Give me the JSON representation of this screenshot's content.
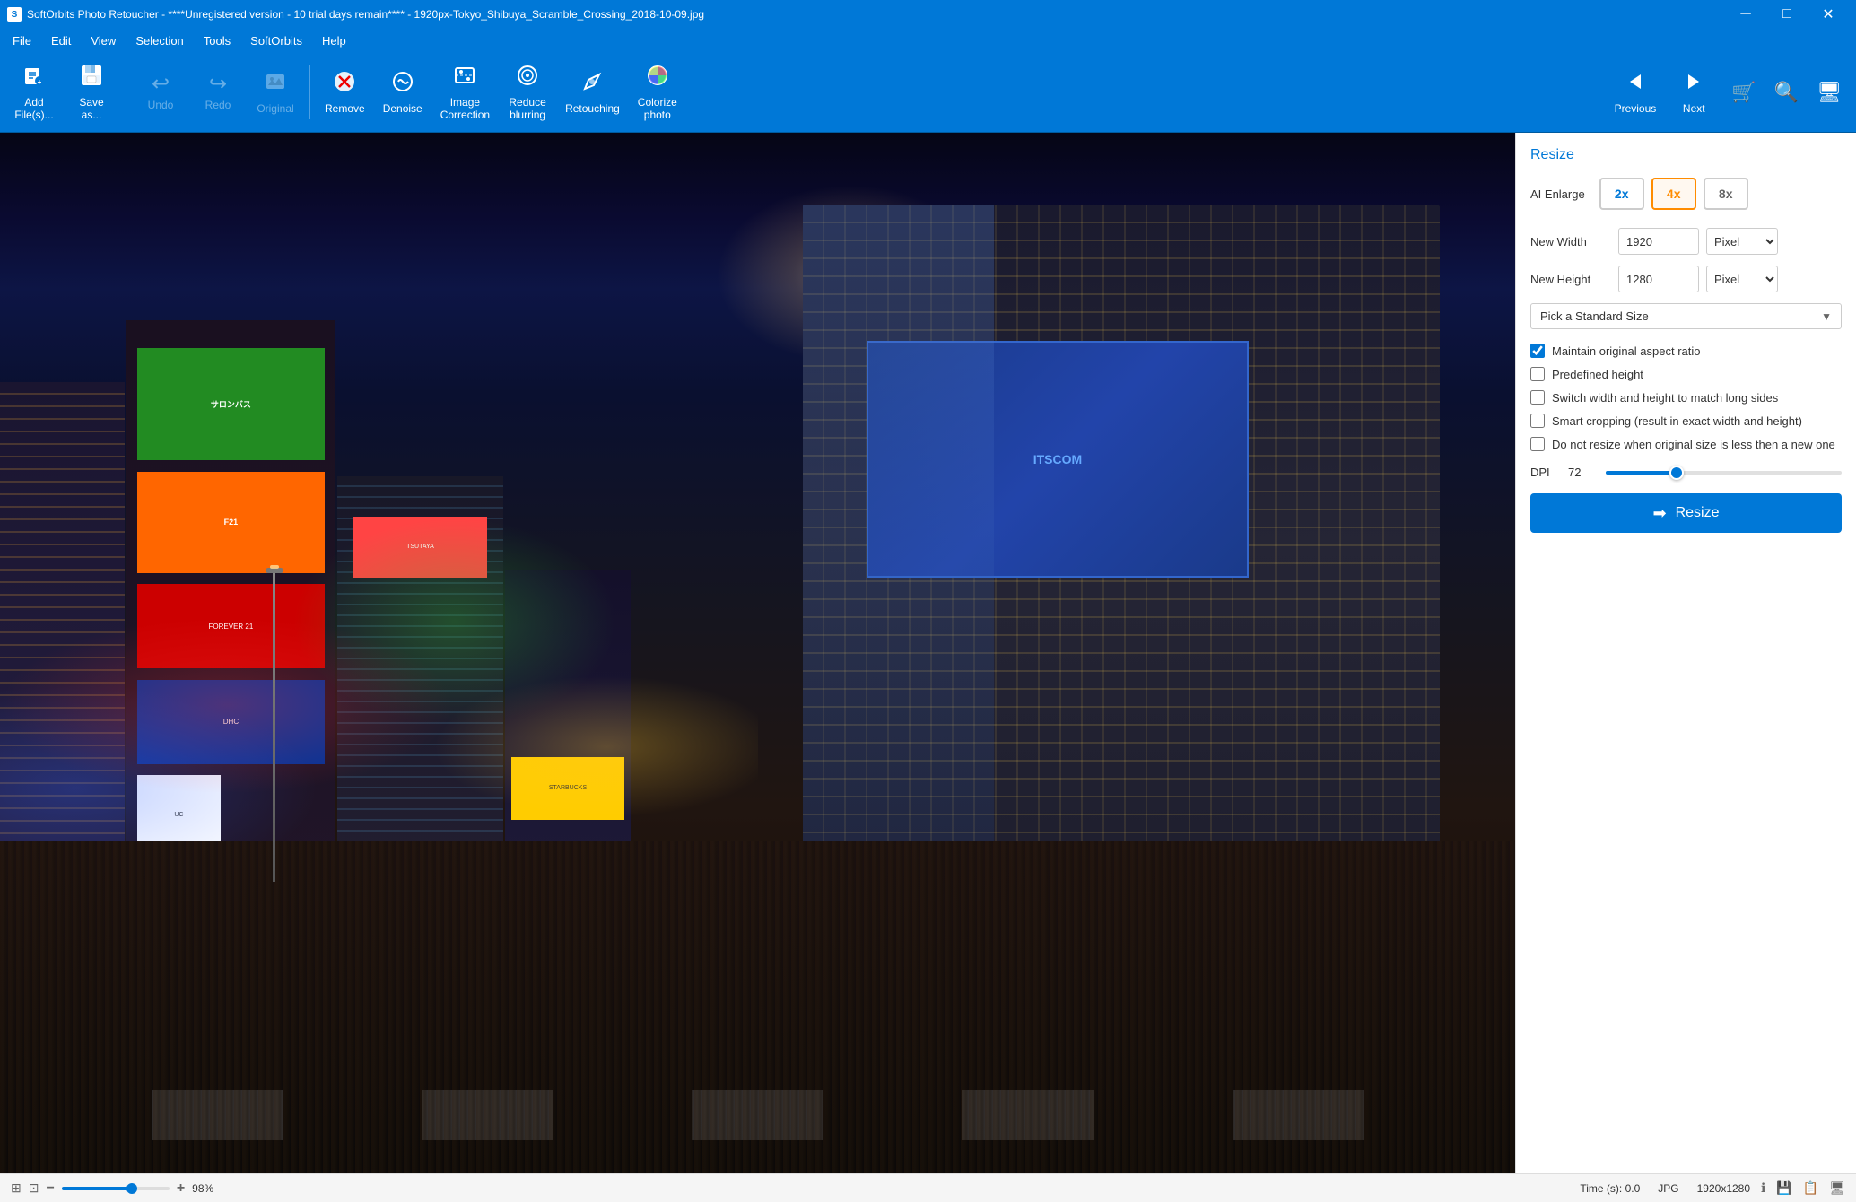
{
  "window": {
    "title": "SoftOrbits Photo Retoucher - ****Unregistered version - 10 trial days remain**** - 1920px-Tokyo_Shibuya_Scramble_Crossing_2018-10-09.jpg",
    "controls": {
      "minimize": "─",
      "maximize": "□",
      "close": "✕"
    }
  },
  "menu": {
    "items": [
      "File",
      "Edit",
      "View",
      "Selection",
      "Tools",
      "SoftOrbits",
      "Help"
    ]
  },
  "toolbar": {
    "buttons": [
      {
        "id": "add-files",
        "icon": "📄",
        "label": "Add\nFile(s)..."
      },
      {
        "id": "save-as",
        "icon": "💾",
        "label": "Save\nas..."
      },
      {
        "id": "undo",
        "icon": "↩",
        "label": "Undo",
        "disabled": true
      },
      {
        "id": "redo",
        "icon": "↪",
        "label": "Redo",
        "disabled": true
      },
      {
        "id": "original",
        "icon": "🖼",
        "label": "Original",
        "disabled": true
      },
      {
        "id": "remove",
        "icon": "✂",
        "label": "Remove"
      },
      {
        "id": "denoise",
        "icon": "🔧",
        "label": "Denoise"
      },
      {
        "id": "image-correction",
        "icon": "⚙",
        "label": "Image\nCorrection"
      },
      {
        "id": "reduce-blurring",
        "icon": "◎",
        "label": "Reduce\nblurring"
      },
      {
        "id": "retouching",
        "icon": "✏",
        "label": "Retouching"
      },
      {
        "id": "colorize-photo",
        "icon": "🎨",
        "label": "Colorize\nphoto"
      }
    ],
    "right_buttons": [
      {
        "id": "previous",
        "icon": "◁",
        "label": "Previous"
      },
      {
        "id": "next",
        "icon": "▷",
        "label": "Next"
      }
    ]
  },
  "right_panel": {
    "title": "Resize",
    "ai_enlarge": {
      "label": "AI Enlarge",
      "options": [
        {
          "value": "2x",
          "label": "2x",
          "active": true
        },
        {
          "value": "4x",
          "label": "4x",
          "active": false
        },
        {
          "value": "8x",
          "label": "8x",
          "active": false
        }
      ]
    },
    "new_width": {
      "label": "New Width",
      "value": "1920",
      "unit": "Pixel"
    },
    "new_height": {
      "label": "New Height",
      "value": "1280",
      "unit": "Pixel"
    },
    "standard_size": {
      "label": "Pick a Standard Size"
    },
    "checkboxes": [
      {
        "id": "maintain-aspect",
        "label": "Maintain original aspect ratio",
        "checked": true
      },
      {
        "id": "predefined-height",
        "label": "Predefined height",
        "checked": false
      },
      {
        "id": "switch-dimensions",
        "label": "Switch width and height to match long sides",
        "checked": false
      },
      {
        "id": "smart-cropping",
        "label": "Smart cropping (result in exact width and height)",
        "checked": false
      },
      {
        "id": "no-resize-smaller",
        "label": "Do not resize when original size is less then a new one",
        "checked": false
      }
    ],
    "dpi": {
      "label": "DPI",
      "value": "72",
      "slider_percent": 30
    },
    "resize_button": {
      "label": "Resize",
      "icon": "➡"
    }
  },
  "status_bar": {
    "time_label": "Time (s):",
    "time_value": "0.0",
    "format": "JPG",
    "dimensions": "1920x1280",
    "zoom_value": "98%",
    "icons": [
      "ℹ",
      "💾",
      "📋",
      "🖥"
    ]
  }
}
